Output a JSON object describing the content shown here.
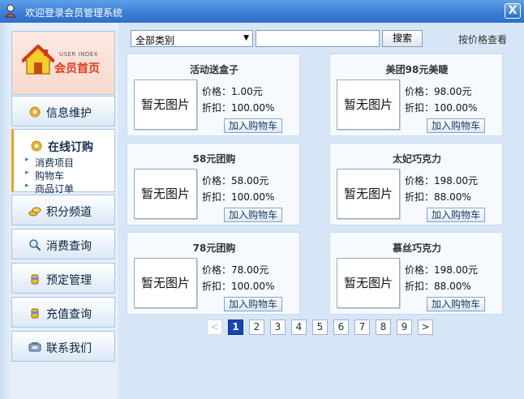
{
  "window": {
    "title": "欢迎登录会员管理系统",
    "close_label": "X"
  },
  "sidebar": {
    "home": {
      "sub_label": "USER INDEX",
      "label": "会员首页"
    },
    "items": [
      {
        "label": "信息维护",
        "icon": "gear-icon"
      },
      {
        "label": "在线订购",
        "icon": "gear-icon",
        "active": true,
        "subitems": [
          "消费项目",
          "购物车",
          "商品订单"
        ]
      },
      {
        "label": "积分频道",
        "icon": "coins-icon"
      },
      {
        "label": "消费查询",
        "icon": "magnifier-icon"
      },
      {
        "label": "预定管理",
        "icon": "cup-icon"
      },
      {
        "label": "充值查询",
        "icon": "cup-icon"
      },
      {
        "label": "联系我们",
        "icon": "phone-icon"
      }
    ]
  },
  "toolbar": {
    "category_selected": "全部类别",
    "search_value": "",
    "search_label": "搜索",
    "sort_label": "按价格查看"
  },
  "products": [
    {
      "name": "活动送盒子",
      "image_text": "暂无图片",
      "price": "价格：1.00元",
      "discount": "折扣：100.00%",
      "cart_label": "加入购物车"
    },
    {
      "name": "美团98元美睫",
      "image_text": "暂无图片",
      "price": "价格：98.00元",
      "discount": "折扣：100.00%",
      "cart_label": "加入购物车"
    },
    {
      "name": "58元团购",
      "image_text": "暂无图片",
      "price": "价格：58.00元",
      "discount": "折扣：100.00%",
      "cart_label": "加入购物车"
    },
    {
      "name": "太妃巧克力",
      "image_text": "暂无图片",
      "price": "价格：198.00元",
      "discount": "折扣：88.00%",
      "cart_label": "加入购物车"
    },
    {
      "name": "78元团购",
      "image_text": "暂无图片",
      "price": "价格：78.00元",
      "discount": "折扣：100.00%",
      "cart_label": "加入购物车"
    },
    {
      "name": "慕丝巧克力",
      "image_text": "暂无图片",
      "price": "价格：198.00元",
      "discount": "折扣：88.00%",
      "cart_label": "加入购物车"
    }
  ],
  "pager": {
    "prev": "<",
    "pages": [
      "1",
      "2",
      "3",
      "4",
      "5",
      "6",
      "7",
      "8",
      "9"
    ],
    "current": "1",
    "next": ">"
  },
  "colors": {
    "accent": "#1446b8",
    "home_label": "#e63a1c",
    "active_marker": "#e6a521"
  }
}
